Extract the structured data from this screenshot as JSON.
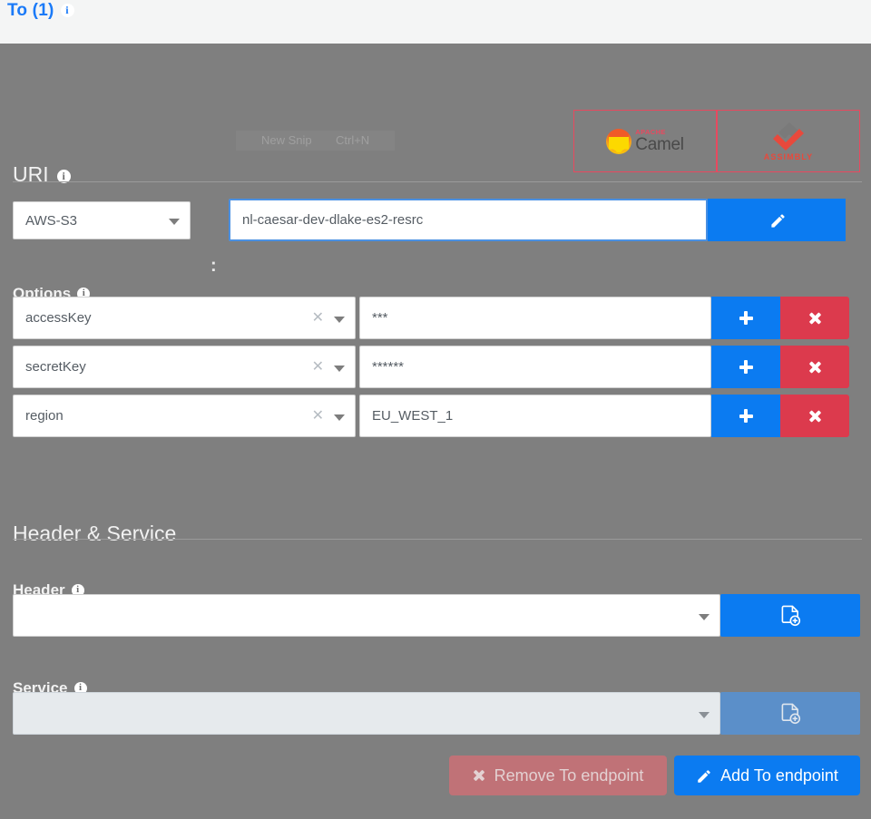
{
  "header": {
    "title": "To (1)",
    "info_icon": "info-icon"
  },
  "branding": {
    "camel": {
      "apache_label": "APACHE",
      "name": "Camel"
    },
    "assimbly": {
      "name": "ASSIMBLY"
    },
    "accent_red": "#e8495f",
    "accent_blue": "#0b7bf1"
  },
  "ghost_menu": {
    "item_label": "New Snip",
    "item_shortcut": "Ctrl+N"
  },
  "uri": {
    "section_title": "URI",
    "component_value": "AWS-S3",
    "separator": ":",
    "path_value": "nl-caesar-dev-dlake-es2-resrc",
    "edit_button_icon": "pencil-icon"
  },
  "options": {
    "section_title": "Options",
    "rows": [
      {
        "key": "accessKey",
        "value": "***",
        "add_icon": "plus-icon",
        "remove_icon": "close-icon"
      },
      {
        "key": "secretKey",
        "value": "******",
        "add_icon": "plus-icon",
        "remove_icon": "close-icon"
      },
      {
        "key": "region",
        "value": "EU_WEST_1",
        "add_icon": "plus-icon",
        "remove_icon": "close-icon"
      }
    ]
  },
  "header_service": {
    "section_title": "Header & Service",
    "header_label": "Header",
    "header_value": "",
    "header_button_icon": "file-add-icon",
    "service_label": "Service",
    "service_value": "",
    "service_button_icon": "file-add-icon"
  },
  "footer": {
    "remove_label": "Remove To endpoint",
    "remove_icon": "close-icon",
    "add_label": "Add To endpoint",
    "add_icon": "pencil-icon"
  }
}
